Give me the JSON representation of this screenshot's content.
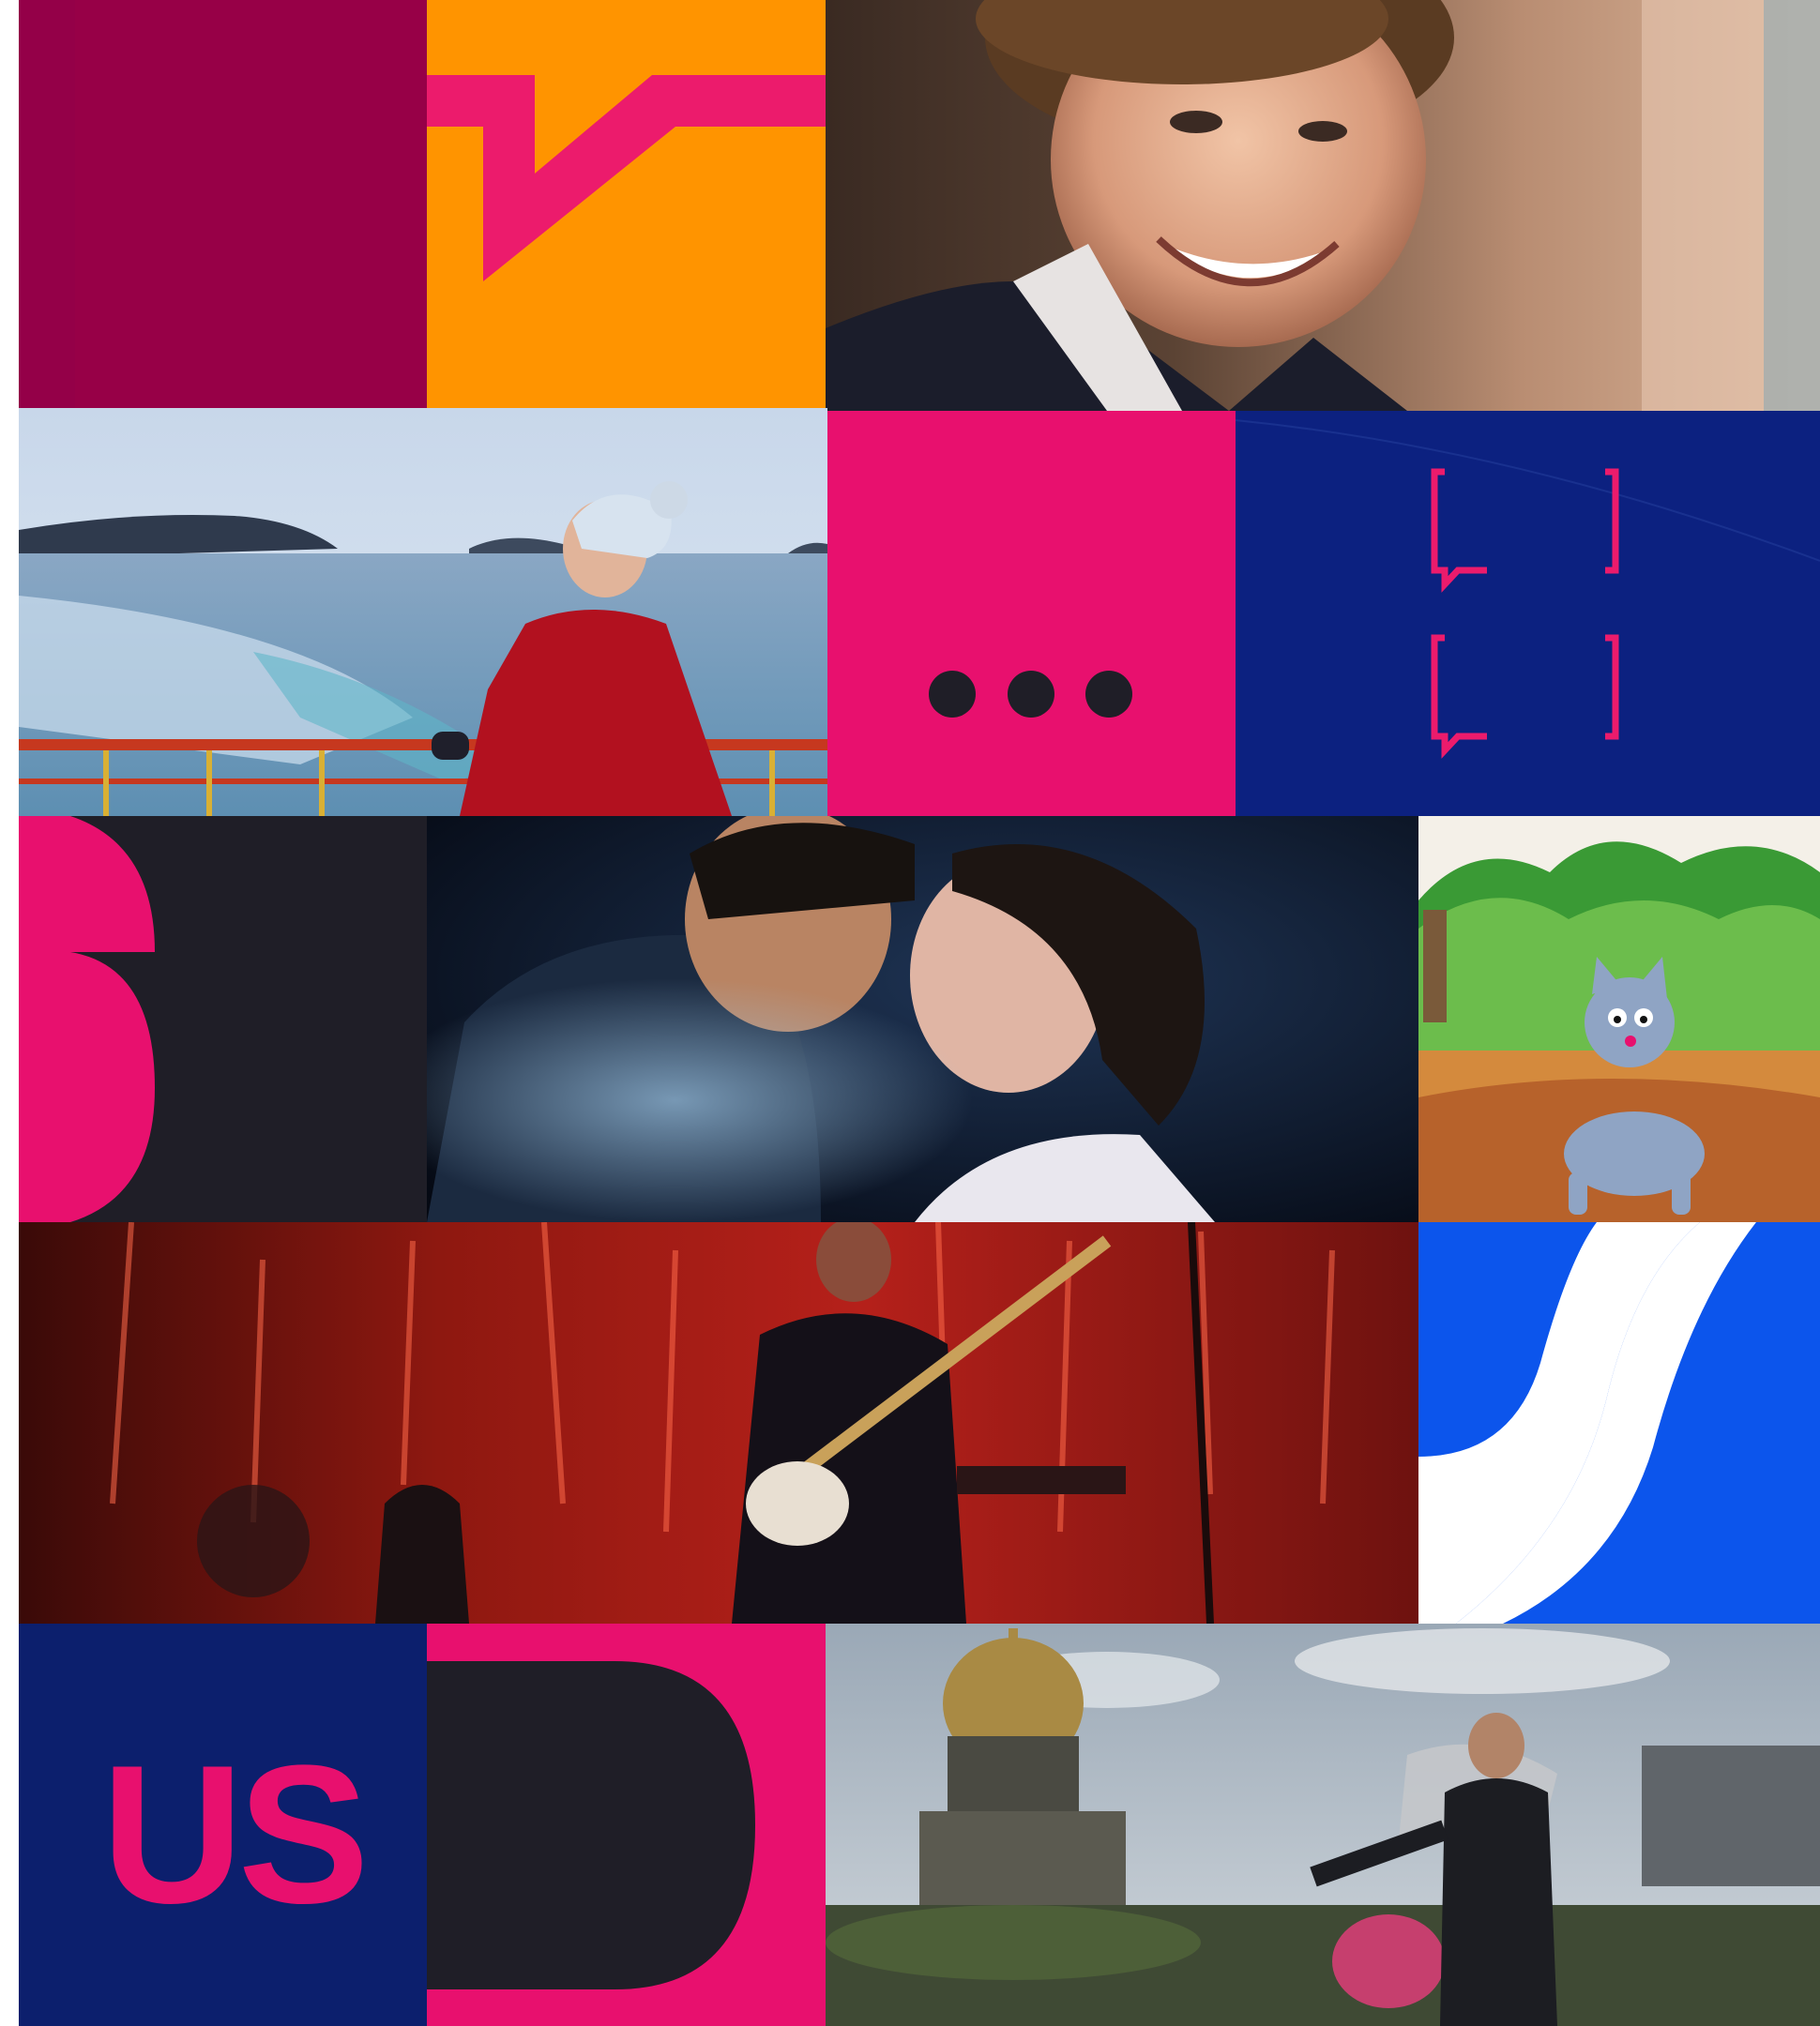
{
  "tiles": {
    "logo_text": "US"
  },
  "colors": {
    "maroon": "#970047",
    "orange": "#ff9400",
    "pink": "#e8106e",
    "navy": "#0c2180",
    "dark": "#1f1e27",
    "blue": "#0c55ec",
    "deep_navy": "#0c1f6d",
    "white": "#ffffff"
  },
  "icons": [
    "check-mark-shape",
    "ellipsis-dots-icon",
    "speech-bracket-icon",
    "six-glyph-shape",
    "wave-s-shape",
    "half-circle-shape"
  ],
  "photos": [
    "smiling-boy-photo",
    "arctic-ship-girl-photo",
    "embracing-couple-photo",
    "cartoon-cat-photo",
    "concert-guitarist-photo",
    "city-rooftop-man-photo"
  ]
}
